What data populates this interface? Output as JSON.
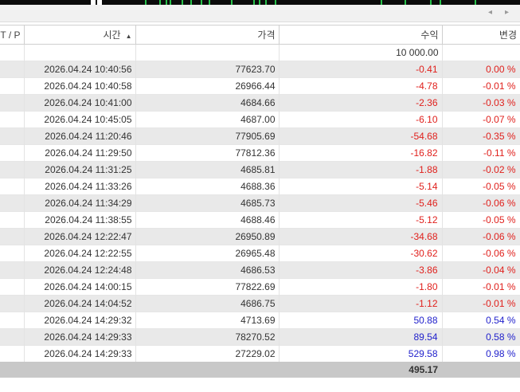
{
  "scrollbar": {
    "left_arrow": "◂",
    "right_arrow": "▸"
  },
  "columns": {
    "tp": "T / P",
    "time": "시간",
    "price": "가격",
    "profit": "수익",
    "change": "변경",
    "sort_indicator": "▲"
  },
  "balance": "10 000.00",
  "rows": [
    {
      "time": "2026.04.24 10:40:56",
      "price": "77623.70",
      "profit": "-0.41",
      "change": "0.00 %"
    },
    {
      "time": "2026.04.24 10:40:58",
      "price": "26966.44",
      "profit": "-4.78",
      "change": "-0.01 %"
    },
    {
      "time": "2026.04.24 10:41:00",
      "price": "4684.66",
      "profit": "-2.36",
      "change": "-0.03 %"
    },
    {
      "time": "2026.04.24 10:45:05",
      "price": "4687.00",
      "profit": "-6.10",
      "change": "-0.07 %"
    },
    {
      "time": "2026.04.24 11:20:46",
      "price": "77905.69",
      "profit": "-54.68",
      "change": "-0.35 %"
    },
    {
      "time": "2026.04.24 11:29:50",
      "price": "77812.36",
      "profit": "-16.82",
      "change": "-0.11 %"
    },
    {
      "time": "2026.04.24 11:31:25",
      "price": "4685.81",
      "profit": "-1.88",
      "change": "-0.02 %"
    },
    {
      "time": "2026.04.24 11:33:26",
      "price": "4688.36",
      "profit": "-5.14",
      "change": "-0.05 %"
    },
    {
      "time": "2026.04.24 11:34:29",
      "price": "4685.73",
      "profit": "-5.46",
      "change": "-0.06 %"
    },
    {
      "time": "2026.04.24 11:38:55",
      "price": "4688.46",
      "profit": "-5.12",
      "change": "-0.05 %"
    },
    {
      "time": "2026.04.24 12:22:47",
      "price": "26950.89",
      "profit": "-34.68",
      "change": "-0.06 %"
    },
    {
      "time": "2026.04.24 12:22:55",
      "price": "26965.48",
      "profit": "-30.62",
      "change": "-0.06 %"
    },
    {
      "time": "2026.04.24 12:24:48",
      "price": "4686.53",
      "profit": "-3.86",
      "change": "-0.04 %"
    },
    {
      "time": "2026.04.24 14:00:15",
      "price": "77822.69",
      "profit": "-1.80",
      "change": "-0.01 %"
    },
    {
      "time": "2026.04.24 14:04:52",
      "price": "4686.75",
      "profit": "-1.12",
      "change": "-0.01 %"
    },
    {
      "time": "2026.04.24 14:29:32",
      "price": "4713.69",
      "profit": "50.88",
      "change": "0.54 %"
    },
    {
      "time": "2026.04.24 14:29:33",
      "price": "78270.52",
      "profit": "89.54",
      "change": "0.58 %"
    },
    {
      "time": "2026.04.24 14:29:33",
      "price": "27229.02",
      "profit": "529.58",
      "change": "0.98 %"
    }
  ],
  "total": "495.17",
  "colors": {
    "negative": "#e0201c",
    "positive": "#2222cc",
    "total_bg": "#c8c8c8"
  }
}
